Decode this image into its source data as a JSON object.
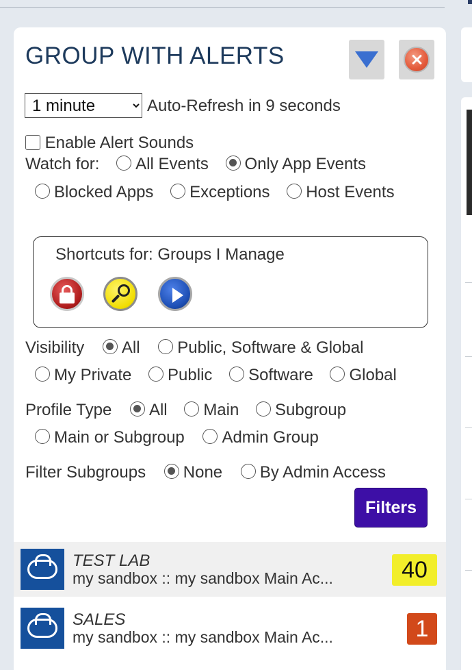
{
  "title": "GROUP WITH ALERTS",
  "refresh": {
    "interval": "1 minute",
    "status": "Auto-Refresh in 9 seconds"
  },
  "alert_sounds_label": "Enable Alert Sounds",
  "watch_for": {
    "label": "Watch for:",
    "options": [
      "All Events",
      "Only App Events",
      "Blocked Apps",
      "Exceptions",
      "Host Events"
    ],
    "selected": "Only App Events"
  },
  "shortcuts": {
    "label": "Shortcuts for: Groups I Manage"
  },
  "visibility": {
    "label": "Visibility",
    "options": [
      "All",
      "Public, Software & Global",
      "My Private",
      "Public",
      "Software",
      "Global"
    ],
    "selected": "All"
  },
  "profile_type": {
    "label": "Profile Type",
    "options": [
      "All",
      "Main",
      "Subgroup",
      "Main or Subgroup",
      "Admin Group"
    ],
    "selected": "All"
  },
  "filter_subgroups": {
    "label": "Filter Subgroups",
    "options": [
      "None",
      "By Admin Access"
    ],
    "selected": "None"
  },
  "filters_button": "Filters",
  "groups": [
    {
      "name": "TEST LAB",
      "path": "my sandbox :: my sandbox Main Ac...",
      "count": "40"
    },
    {
      "name": "SALES",
      "path": "my sandbox :: my sandbox Main Ac...",
      "count": "1"
    }
  ],
  "colors": {
    "title": "#1d3a5c",
    "filters_button": "#3d0fa6",
    "badge_yellow": "#f2ee2a",
    "badge_orange": "#d2491a",
    "avatar": "#15509c"
  }
}
